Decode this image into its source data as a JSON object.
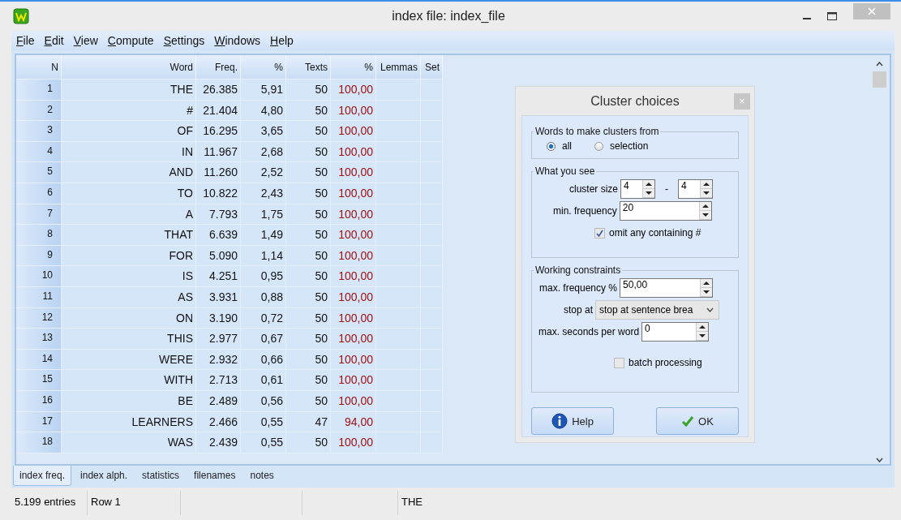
{
  "window": {
    "title": "index file: index_file"
  },
  "menu": [
    {
      "label": "File"
    },
    {
      "label": "Edit"
    },
    {
      "label": "View"
    },
    {
      "label": "Compute"
    },
    {
      "label": "Settings"
    },
    {
      "label": "Windows"
    },
    {
      "label": "Help"
    }
  ],
  "table": {
    "columns": [
      "N",
      "Word",
      "Freq.",
      "%",
      "Texts",
      "%",
      "Lemmas",
      "Set"
    ],
    "rows": [
      [
        "1",
        "THE",
        "26.385",
        "5,91",
        "50",
        "100,00"
      ],
      [
        "2",
        "#",
        "21.404",
        "4,80",
        "50",
        "100,00"
      ],
      [
        "3",
        "OF",
        "16.295",
        "3,65",
        "50",
        "100,00"
      ],
      [
        "4",
        "IN",
        "11.967",
        "2,68",
        "50",
        "100,00"
      ],
      [
        "5",
        "AND",
        "11.260",
        "2,52",
        "50",
        "100,00"
      ],
      [
        "6",
        "TO",
        "10.822",
        "2,43",
        "50",
        "100,00"
      ],
      [
        "7",
        "A",
        "7.793",
        "1,75",
        "50",
        "100,00"
      ],
      [
        "8",
        "THAT",
        "6.639",
        "1,49",
        "50",
        "100,00"
      ],
      [
        "9",
        "FOR",
        "5.090",
        "1,14",
        "50",
        "100,00"
      ],
      [
        "10",
        "IS",
        "4.251",
        "0,95",
        "50",
        "100,00"
      ],
      [
        "11",
        "AS",
        "3.931",
        "0,88",
        "50",
        "100,00"
      ],
      [
        "12",
        "ON",
        "3.190",
        "0,72",
        "50",
        "100,00"
      ],
      [
        "13",
        "THIS",
        "2.977",
        "0,67",
        "50",
        "100,00"
      ],
      [
        "14",
        "WERE",
        "2.932",
        "0,66",
        "50",
        "100,00"
      ],
      [
        "15",
        "WITH",
        "2.713",
        "0,61",
        "50",
        "100,00"
      ],
      [
        "16",
        "BE",
        "2.489",
        "0,56",
        "50",
        "100,00"
      ],
      [
        "17",
        "LEARNERS",
        "2.466",
        "0,55",
        "47",
        "94,00"
      ],
      [
        "18",
        "WAS",
        "2.439",
        "0,55",
        "50",
        "100,00"
      ]
    ]
  },
  "dialog": {
    "title": "Cluster choices",
    "close": "×",
    "words_group": {
      "legend": "Words to make clusters from",
      "options": [
        {
          "label": "all",
          "selected": true
        },
        {
          "label": "selection",
          "selected": false
        }
      ]
    },
    "see_group": {
      "legend": "What you see",
      "cluster_size_label": "cluster size",
      "cluster_min": "4",
      "dash": "-",
      "cluster_max": "4",
      "min_frequency_label": "min. frequency",
      "min_frequency": "20",
      "omit_label": "omit any containing #",
      "omit_checked": true
    },
    "constraints_group": {
      "legend": "Working constraints",
      "max_frequency_label": "max. frequency %",
      "max_frequency": "50,00",
      "stop_at_label": "stop at",
      "stop_at": "stop at sentence brea",
      "max_seconds_label": "max. seconds per word",
      "max_seconds": "0",
      "batch_label": "batch processing",
      "batch_checked": false
    },
    "buttons": [
      {
        "label": "Help",
        "kind": "help"
      },
      {
        "label": "OK",
        "kind": "ok"
      }
    ]
  },
  "tabs": [
    {
      "label": "index freq.",
      "selected": true
    },
    {
      "label": "index alph.",
      "selected": false
    },
    {
      "label": "statistics",
      "selected": false
    },
    {
      "label": "filenames",
      "selected": false
    },
    {
      "label": "notes",
      "selected": false
    }
  ],
  "status_bar": {
    "entries": "5.199 entries",
    "row": "Row 1",
    "word": "THE"
  }
}
